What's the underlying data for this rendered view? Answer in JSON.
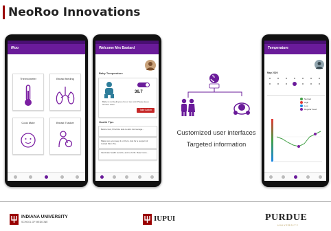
{
  "slide": {
    "title": "NeoRoo Innovations"
  },
  "phone1": {
    "app_title": "iRoo",
    "cards": [
      {
        "label": "Thermometer",
        "icon": "thermometer-icon"
      },
      {
        "label": "Breast feeding",
        "icon": "lungs-icon"
      },
      {
        "label": "Cook Mate",
        "icon": "baby-icon"
      },
      {
        "label": "Breast Tracker",
        "icon": "mother-baby-icon"
      }
    ]
  },
  "phone2": {
    "app_title": "Welcome Mrs Bastard",
    "section_title": "Baby Temperature",
    "temp_value": "36.7",
    "temp_note": "Baby is not feeling too hot or too cold. Please keep him/her warm.",
    "action_label": "Take Action",
    "tips_title": "Health Tips",
    "tips": [
      "Before bed, Prioritize skin-to-skin. Encourage...",
      "Make sure you keep it on Kuru. Ask for a support of trusted Mom Tip...",
      "Vaccinate health records, and so forth. Read more..."
    ]
  },
  "middle": {
    "icons": [
      "phone-hand-icon",
      "family-icon",
      "baby-tracker-icon"
    ],
    "line1": "Customized user interfaces",
    "line2": "Targeted information"
  },
  "phone3": {
    "app_title": "Temperature",
    "calendar_header": "May 2020",
    "legend": [
      {
        "label": "Normal",
        "color": "#43a047"
      },
      {
        "label": "High",
        "color": "#e53935"
      },
      {
        "label": "Low",
        "color": "#1e88e5"
      },
      {
        "label": "Regular Feed",
        "color": "#7b1fa2"
      }
    ]
  },
  "logos": {
    "iu_name": "INDIANA UNIVERSITY",
    "iu_sub": "SCHOOL OF MEDICINE",
    "iupui": "IUPUI",
    "purdue": "PURDUE",
    "purdue_sub": "UNIVERSITY"
  },
  "colors": {
    "purple": "#6a1b9a",
    "iu_crimson": "#990000",
    "purdue_gold": "#b59a57"
  }
}
